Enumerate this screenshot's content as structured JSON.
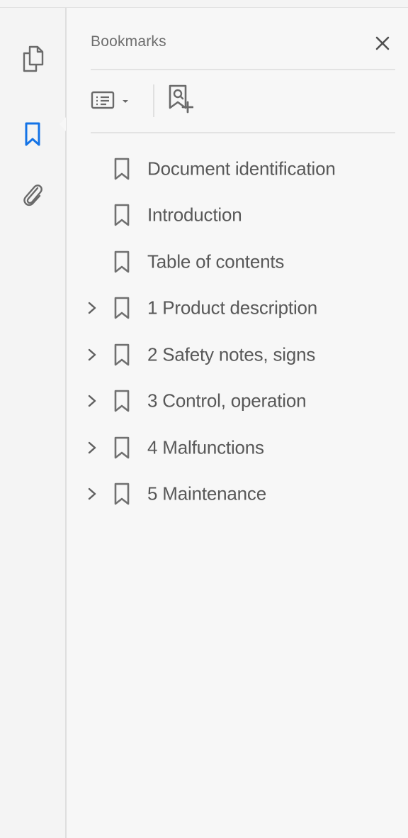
{
  "colors": {
    "accent": "#1473e6",
    "icon_gray": "#6a6a6a",
    "text": "#585858",
    "background": "#f7f7f7"
  },
  "rail": {
    "items": [
      {
        "icon": "pages-icon",
        "active": false
      },
      {
        "icon": "bookmark-icon",
        "active": true
      },
      {
        "icon": "paperclip-icon",
        "active": false
      }
    ]
  },
  "panel": {
    "title": "Bookmarks",
    "close_icon": "close-icon",
    "toolbar": {
      "options_icon": "options-icon",
      "dropdown_icon": "caret-down-icon",
      "new_bookmark_icon": "new-bookmark-icon"
    }
  },
  "bookmarks": [
    {
      "label": "Document identification",
      "expandable": false
    },
    {
      "label": "Introduction",
      "expandable": false
    },
    {
      "label": "Table of contents",
      "expandable": false
    },
    {
      "label": "1 Product description",
      "expandable": true
    },
    {
      "label": "2 Safety notes, signs",
      "expandable": true
    },
    {
      "label": "3 Control, operation",
      "expandable": true
    },
    {
      "label": "4 Malfunctions",
      "expandable": true
    },
    {
      "label": "5 Maintenance",
      "expandable": true
    }
  ]
}
